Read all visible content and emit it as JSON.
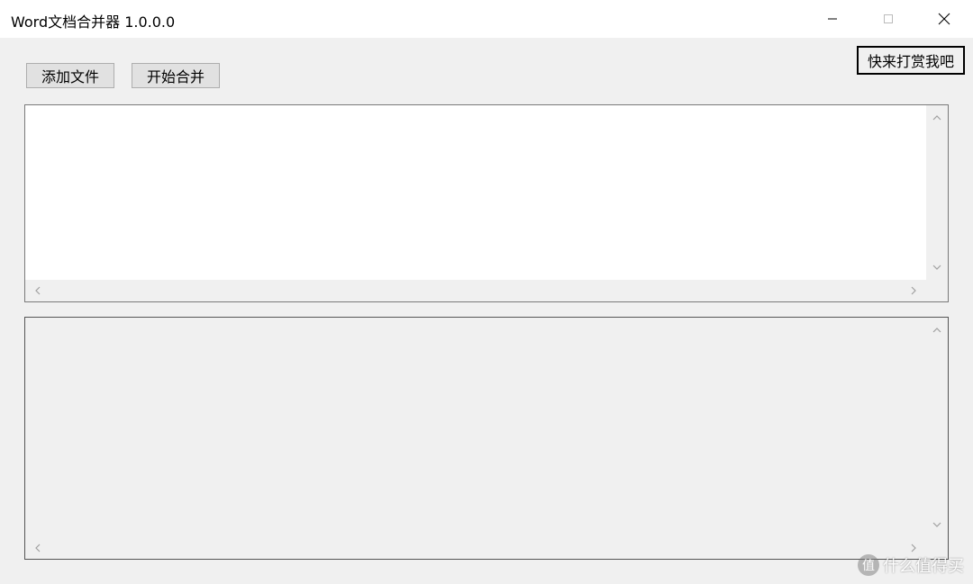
{
  "window": {
    "title": "Word文档合并器 1.0.0.0"
  },
  "toolbar": {
    "add_files_label": "添加文件",
    "start_merge_label": "开始合并",
    "donate_label": "快来打赏我吧"
  },
  "icons": {
    "minimize": "minimize-icon",
    "maximize": "maximize-icon",
    "close": "close-icon",
    "scroll_up": "chevron-up-icon",
    "scroll_down": "chevron-down-icon",
    "scroll_left": "chevron-left-icon",
    "scroll_right": "chevron-right-icon"
  },
  "watermark": {
    "logo_text": "值",
    "text": "什么值得买"
  },
  "colors": {
    "window_bg": "#f0f0f0",
    "titlebar_bg": "#ffffff",
    "button_bg": "#e1e1e1",
    "file_list_bg": "#ffffff"
  }
}
